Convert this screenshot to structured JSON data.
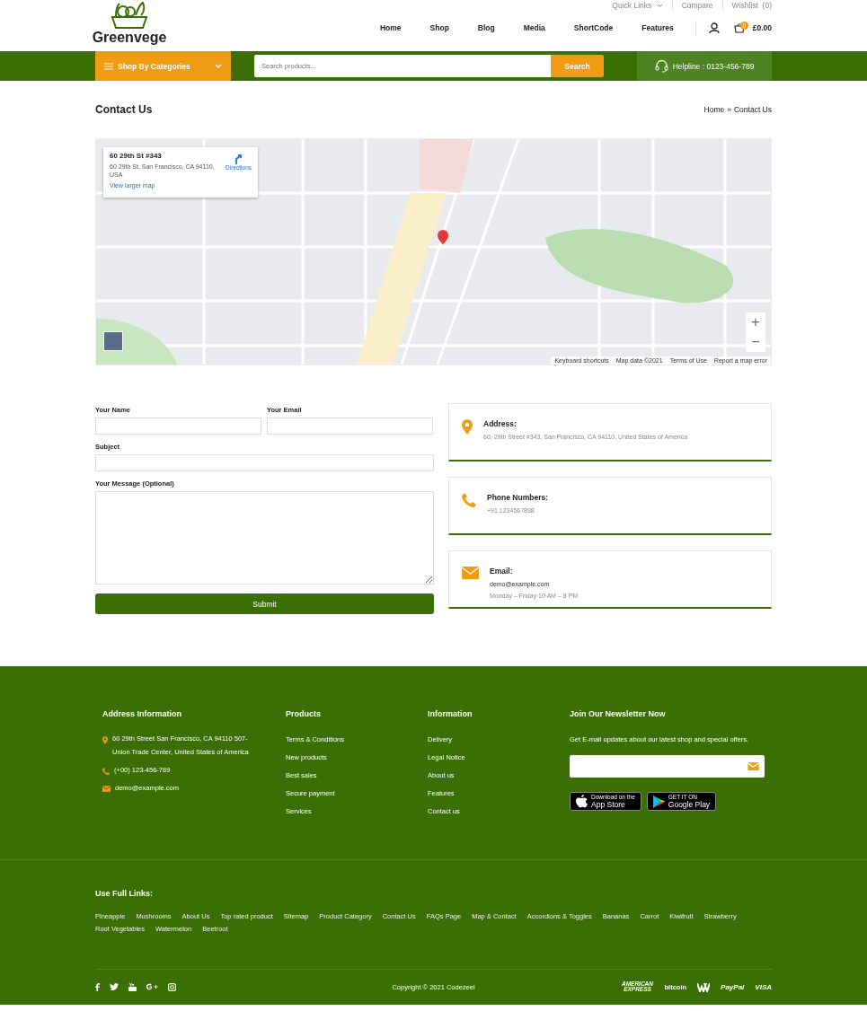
{
  "header": {
    "logo": "Greenvege",
    "quick_links": "Quick Links",
    "top_links": [
      "Compare",
      "Wishlist  (0)"
    ],
    "nav": [
      "Home",
      "Shop",
      "Blog",
      "Media",
      "ShortCode",
      "Features"
    ],
    "cart": {
      "count": "0",
      "total": "£0.00"
    }
  },
  "bar": {
    "categories": "Shop By Categories",
    "search_placeholder": "Search products...",
    "search_button": "Search",
    "helpline": "Helpline : 0123-456-789"
  },
  "page_title": "Contact Us",
  "breadcrumb": {
    "items": [
      "Home",
      "Contact Us"
    ],
    "separator": "»"
  },
  "map": {
    "info_card": {
      "title": "60 29th St #343",
      "address": "60 29th St, San Francisco, CA 94110, USA",
      "directions": "Directions",
      "link": "View larger map"
    },
    "zoom": [
      "+",
      "−"
    ],
    "attribution": [
      "Keyboard shortcuts",
      "Map data ©2021",
      "Terms of Use",
      "Report a map error"
    ]
  },
  "form": {
    "fields": [
      {
        "label": "Your Name",
        "kind": "half"
      },
      {
        "label": "Your Email",
        "kind": "half"
      },
      {
        "label": "Subject",
        "kind": "full"
      },
      {
        "label": "Your Message (Optional)",
        "kind": "area"
      }
    ],
    "submit": "Submit"
  },
  "contact_cards": [
    {
      "kind": "address",
      "title": "Address:",
      "lines": [
        "60, 29th Street #343, San Francisco, CA 94110, United States of America"
      ]
    },
    {
      "kind": "phone",
      "title": "Phone Numbers:",
      "lines": [
        "+91 1234567898"
      ]
    },
    {
      "kind": "email",
      "title": "Email:",
      "lines": [
        "demo@example.com",
        "Monday – Friday 10 AM – 8 PM"
      ]
    }
  ],
  "footer": {
    "address_title": "Address Information",
    "address_items": [
      {
        "kind": "pin",
        "text": "60 29th Street San Francisco, CA 94110 507-Union Trade Center, United States of America"
      },
      {
        "kind": "phone",
        "text": "(+00) 123-456-789"
      },
      {
        "kind": "email",
        "text": "demo@example.com"
      }
    ],
    "columns": [
      {
        "title": "Products",
        "links": [
          "Terms & Conditions",
          "New products",
          "Best sales",
          "Secure payment",
          "Services"
        ]
      },
      {
        "title": "Information",
        "links": [
          "Delivery",
          "Legal Notice",
          "About us",
          "Features",
          "Contact us"
        ]
      }
    ],
    "newsletter": {
      "title": "Join Our Newsletter Now",
      "text": "Get E-mail updates about our latest shop and special offers."
    },
    "badges": [
      {
        "kind": "apple",
        "small": "Download on the",
        "big": "App Store"
      },
      {
        "kind": "google",
        "small": "GET IT ON",
        "big": "Google Play"
      }
    ],
    "useful_title": "Use Full Links:",
    "useful_links": [
      "Pineapple",
      "Mushrooms",
      "About Us",
      "Top rated product",
      "Sitemap",
      "Product Category",
      "Contact Us",
      "FAQs Page",
      "Map & Contact",
      "Accordions & Toggles",
      "Bananas",
      "Carrot",
      "Kiwifruit",
      "Strawberry",
      "Root Vegetables",
      "Watermelon",
      "Beetroot"
    ],
    "copyright": "Copyright © 2021 Codezeel",
    "payments": [
      {
        "kind": "amex",
        "text": "AMERICAN EXPRESS"
      },
      {
        "kind": "bitcoin",
        "text": "bitcoin"
      },
      {
        "kind": "paypal",
        "text": "PayPal"
      },
      {
        "kind": "visa",
        "text": "VISA"
      }
    ]
  }
}
